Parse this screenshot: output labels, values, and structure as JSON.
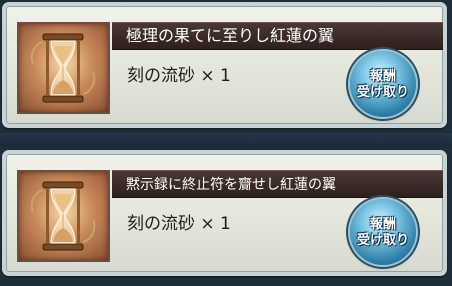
{
  "rewards": [
    {
      "title": "極理の果てに至りし紅蓮の翼",
      "item_icon": "hourglass-icon",
      "item_text": "刻の流砂 × 1",
      "claim_line1": "報酬",
      "claim_line2": "受け取り"
    },
    {
      "title": "黙示録に終止符を齎せし紅蓮の翼",
      "item_icon": "hourglass-icon",
      "item_text": "刻の流砂 × 1",
      "claim_line1": "報酬",
      "claim_line2": "受け取り"
    }
  ],
  "colors": {
    "title_bar": "#3a2a26",
    "card_background": "#e9eae1",
    "claim_button": "#3f9ac2"
  }
}
